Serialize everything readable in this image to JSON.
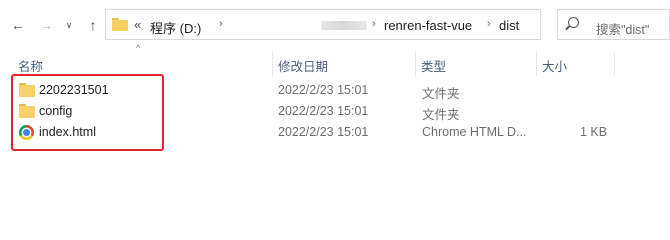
{
  "toolbar": {
    "back_icon": "arrow-left-icon",
    "forward_icon": "arrow-right-icon",
    "recent_icon": "chevron-down-icon",
    "up_icon": "arrow-up-icon"
  },
  "address": {
    "chevrons": "«",
    "crumbs": [
      "程序 (D:)",
      "renren-fast-vue",
      "dist"
    ],
    "separator": "›",
    "dropdown": "∨",
    "refresh": "↻"
  },
  "search": {
    "placeholder": "搜索\"dist\""
  },
  "columns": {
    "name": "名称",
    "modified": "修改日期",
    "type": "类型",
    "size": "大小"
  },
  "files": [
    {
      "name": "2202231501",
      "modified": "2022/2/23 15:01",
      "type": "文件夹",
      "size": "",
      "icon": "folder-icon"
    },
    {
      "name": "config",
      "modified": "2022/2/23 15:01",
      "type": "文件夹",
      "size": "",
      "icon": "folder-icon"
    },
    {
      "name": "index.html",
      "modified": "2022/2/23 15:01",
      "type": "Chrome HTML D...",
      "size": "1 KB",
      "icon": "chrome-icon"
    }
  ],
  "colors": {
    "highlight": "#e3262b",
    "header_text": "#4c607a"
  }
}
